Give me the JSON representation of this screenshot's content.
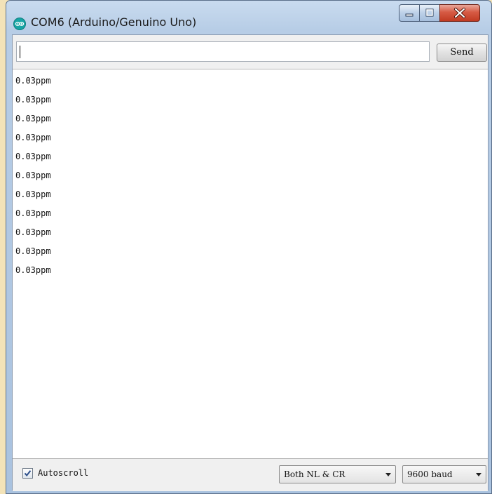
{
  "window": {
    "title": "COM6 (Arduino/Genuino Uno)"
  },
  "input": {
    "value": ""
  },
  "toolbar": {
    "send_label": "Send"
  },
  "output": {
    "lines": [
      "0.03ppm",
      "0.03ppm",
      "0.03ppm",
      "0.03ppm",
      "0.03ppm",
      "0.03ppm",
      "0.03ppm",
      "0.03ppm",
      "0.03ppm",
      "0.03ppm",
      "0.03ppm"
    ]
  },
  "footer": {
    "autoscroll_label": "Autoscroll",
    "autoscroll_checked": true,
    "line_ending": "Both NL & CR",
    "baud_rate": "9600 baud"
  },
  "icons": {
    "app": "arduino-logo-icon",
    "minimize": "minimize-icon",
    "maximize": "maximize-icon",
    "close": "close-icon",
    "check": "check-icon",
    "dropdown": "chevron-down-icon"
  }
}
